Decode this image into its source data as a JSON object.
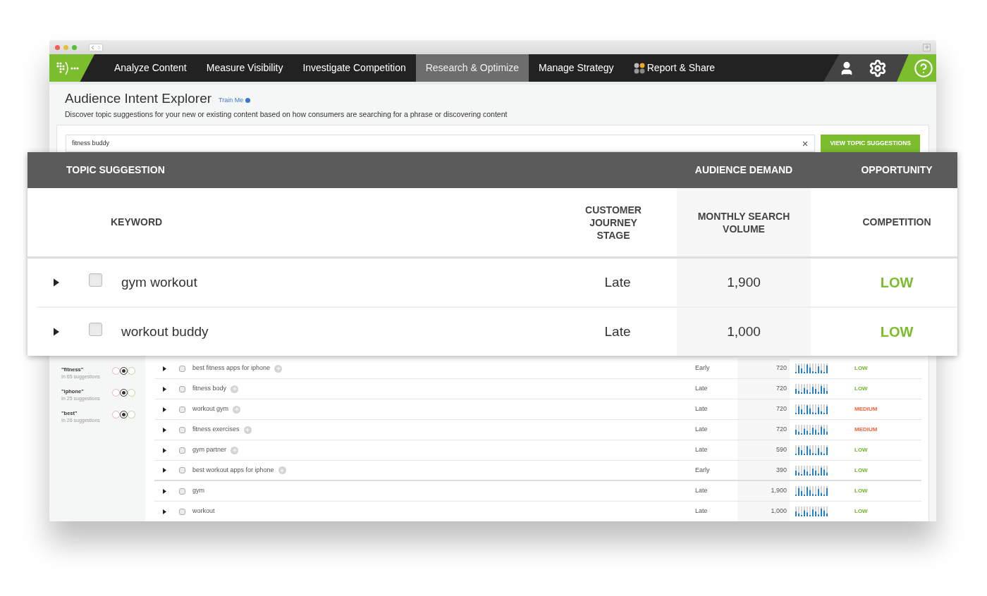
{
  "nav": {
    "items": [
      {
        "label": "Analyze Content",
        "selected": false,
        "kind": "text"
      },
      {
        "label": "Measure Visibility",
        "selected": false,
        "kind": "text"
      },
      {
        "label": "Investigate Competition",
        "selected": false,
        "kind": "text"
      },
      {
        "label": "Research & Optimize",
        "selected": true,
        "kind": "text"
      },
      {
        "label": "Manage Strategy",
        "selected": false,
        "kind": "text"
      },
      {
        "label": "Report & Share",
        "selected": false,
        "kind": "dots"
      }
    ]
  },
  "page": {
    "title": "Audience Intent Explorer",
    "train_link": "Train Me",
    "description": "Discover topic suggestions for your new or existing content based on how consumers are searching for a phrase or discovering content"
  },
  "search": {
    "value": "fitness buddy",
    "button": "VIEW TOPIC SUGGESTIONS"
  },
  "sidebar": {
    "terms": [
      {
        "label": "\"fitness\"",
        "count": "In 65 suggestions",
        "options": [
          {
            "color": "#e8b4b4",
            "selected": false
          },
          {
            "color": "#333333",
            "selected": true
          },
          {
            "color": "#b8d8a0",
            "selected": false
          }
        ]
      },
      {
        "label": "\"iphone\"",
        "count": "In 25 suggestions",
        "options": [
          {
            "color": "#e8b4b4",
            "selected": false
          },
          {
            "color": "#333333",
            "selected": true
          },
          {
            "color": "#b8d8a0",
            "selected": false
          }
        ]
      },
      {
        "label": "\"best\"",
        "count": "In 26 suggestions",
        "options": [
          {
            "color": "#e8b4b4",
            "selected": false
          },
          {
            "color": "#333333",
            "selected": true
          },
          {
            "color": "#b8d8a0",
            "selected": false
          }
        ]
      }
    ]
  },
  "table": {
    "groups": [
      [
        {
          "keyword": "best fitness apps for iphone",
          "addable": true,
          "checked": false,
          "stage": "Early",
          "volume": "720",
          "competition": "LOW",
          "color": "#6fb42c"
        },
        {
          "keyword": "fitness body",
          "addable": true,
          "checked": false,
          "stage": "Late",
          "volume": "720",
          "competition": "LOW",
          "color": "#6fb42c"
        },
        {
          "keyword": "workout gym",
          "addable": true,
          "checked": false,
          "stage": "Late",
          "volume": "720",
          "competition": "MEDIUM",
          "color": "#f0643c"
        },
        {
          "keyword": "fitness exercises",
          "addable": true,
          "checked": false,
          "stage": "Late",
          "volume": "720",
          "competition": "MEDIUM",
          "color": "#f0643c"
        },
        {
          "keyword": "gym partner",
          "addable": true,
          "checked": false,
          "stage": "Late",
          "volume": "590",
          "competition": "LOW",
          "color": "#6fb42c"
        },
        {
          "keyword": "best workout apps for iphone",
          "addable": true,
          "checked": false,
          "stage": "Early",
          "volume": "390",
          "competition": "LOW",
          "color": "#6fb42c"
        }
      ],
      [
        {
          "keyword": "gym",
          "addable": false,
          "checked": false,
          "stage": "Late",
          "volume": "1,900",
          "competition": "LOW",
          "color": "#6fb42c"
        },
        {
          "keyword": "workout",
          "addable": false,
          "checked": false,
          "stage": "Late",
          "volume": "1,000",
          "competition": "LOW",
          "color": "#6fb42c"
        }
      ]
    ]
  },
  "zoom_card": {
    "header": {
      "topic": "TOPIC SUGGESTION",
      "demand": "AUDIENCE DEMAND",
      "opportunity": "OPPORTUNITY"
    },
    "columns": {
      "keyword": "KEYWORD",
      "stage": "CUSTOMER JOURNEY STAGE",
      "volume": "MONTHLY SEARCH VOLUME",
      "competition": "COMPETITION"
    },
    "rows": [
      {
        "keyword": "gym workout",
        "checked": false,
        "stage": "Late",
        "volume": "1,900",
        "competition": "LOW",
        "color": "#7cbd2e"
      },
      {
        "keyword": "workout buddy",
        "checked": false,
        "stage": "Late",
        "volume": "1,000",
        "competition": "LOW",
        "color": "#7cbd2e"
      }
    ]
  }
}
